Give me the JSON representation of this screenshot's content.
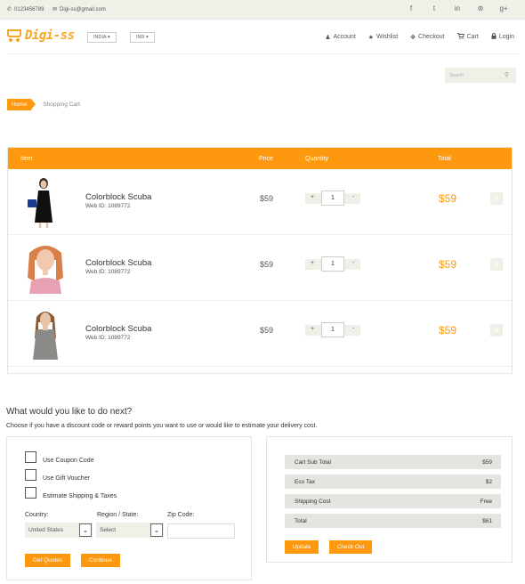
{
  "topbar": {
    "phone": "0123456789",
    "email": "Digi-ss@gmail.com",
    "social": [
      "facebook-icon",
      "twitter-icon",
      "linkedin-icon",
      "dribbble-icon",
      "google-plus-icon"
    ],
    "social_glyphs": [
      "f",
      "t",
      "in",
      "⊛",
      "g+"
    ]
  },
  "header": {
    "logo_text": "Digi-ss",
    "country": "INDIA",
    "currency": "INR",
    "nav": [
      {
        "label": "Account",
        "icon": "user-icon",
        "glyph": "♟"
      },
      {
        "label": "Wishlist",
        "icon": "star-icon",
        "glyph": "★"
      },
      {
        "label": "Checkout",
        "icon": "crosshair-icon",
        "glyph": "✥"
      },
      {
        "label": "Cart",
        "icon": "cart-icon",
        "glyph": "🛒"
      },
      {
        "label": "Login",
        "icon": "lock-icon",
        "glyph": "🔒"
      }
    ]
  },
  "search": {
    "placeholder": "Search"
  },
  "breadcrumb": {
    "home": "Home",
    "current": "Shopping Cart"
  },
  "cart": {
    "headers": {
      "item": "Item",
      "price": "Price",
      "quantity": "Quantity",
      "total": "Total"
    },
    "rows": [
      {
        "name": "Colorblock Scuba",
        "web_id": "Web ID: 1089772",
        "price": "$59",
        "qty": "1",
        "total": "$59"
      },
      {
        "name": "Colorblock Scuba",
        "web_id": "Web ID: 1089772",
        "price": "$59",
        "qty": "1",
        "total": "$59"
      },
      {
        "name": "Colorblock Scuba",
        "web_id": "Web ID: 1089772",
        "price": "$59",
        "qty": "1",
        "total": "$59"
      }
    ]
  },
  "next": {
    "heading": "What would you like to do next?",
    "desc": "Choose if you have a discount code or reward points you want to use or would like to estimate your delivery cost.",
    "options": [
      "Use Coupon Code",
      "Use Gift Voucher",
      "Estimate Shipping & Taxes"
    ],
    "country_label": "Country:",
    "country_value": "United States",
    "region_label": "Region / State:",
    "region_value": "Select",
    "zip_label": "Zip Code:",
    "zip_value": "",
    "get_quotes": "Get Quotes",
    "continue": "Continue"
  },
  "summary": {
    "rows": [
      {
        "label": "Cart Sub Total",
        "value": "$59"
      },
      {
        "label": "Eco Tax",
        "value": "$2"
      },
      {
        "label": "Shipping Cost",
        "value": "Free"
      },
      {
        "label": "Total",
        "value": "$61"
      }
    ],
    "update": "Update",
    "checkout": "Check Out"
  },
  "colors": {
    "accent": "#fe980f",
    "light_bg": "#f0f0e9"
  }
}
